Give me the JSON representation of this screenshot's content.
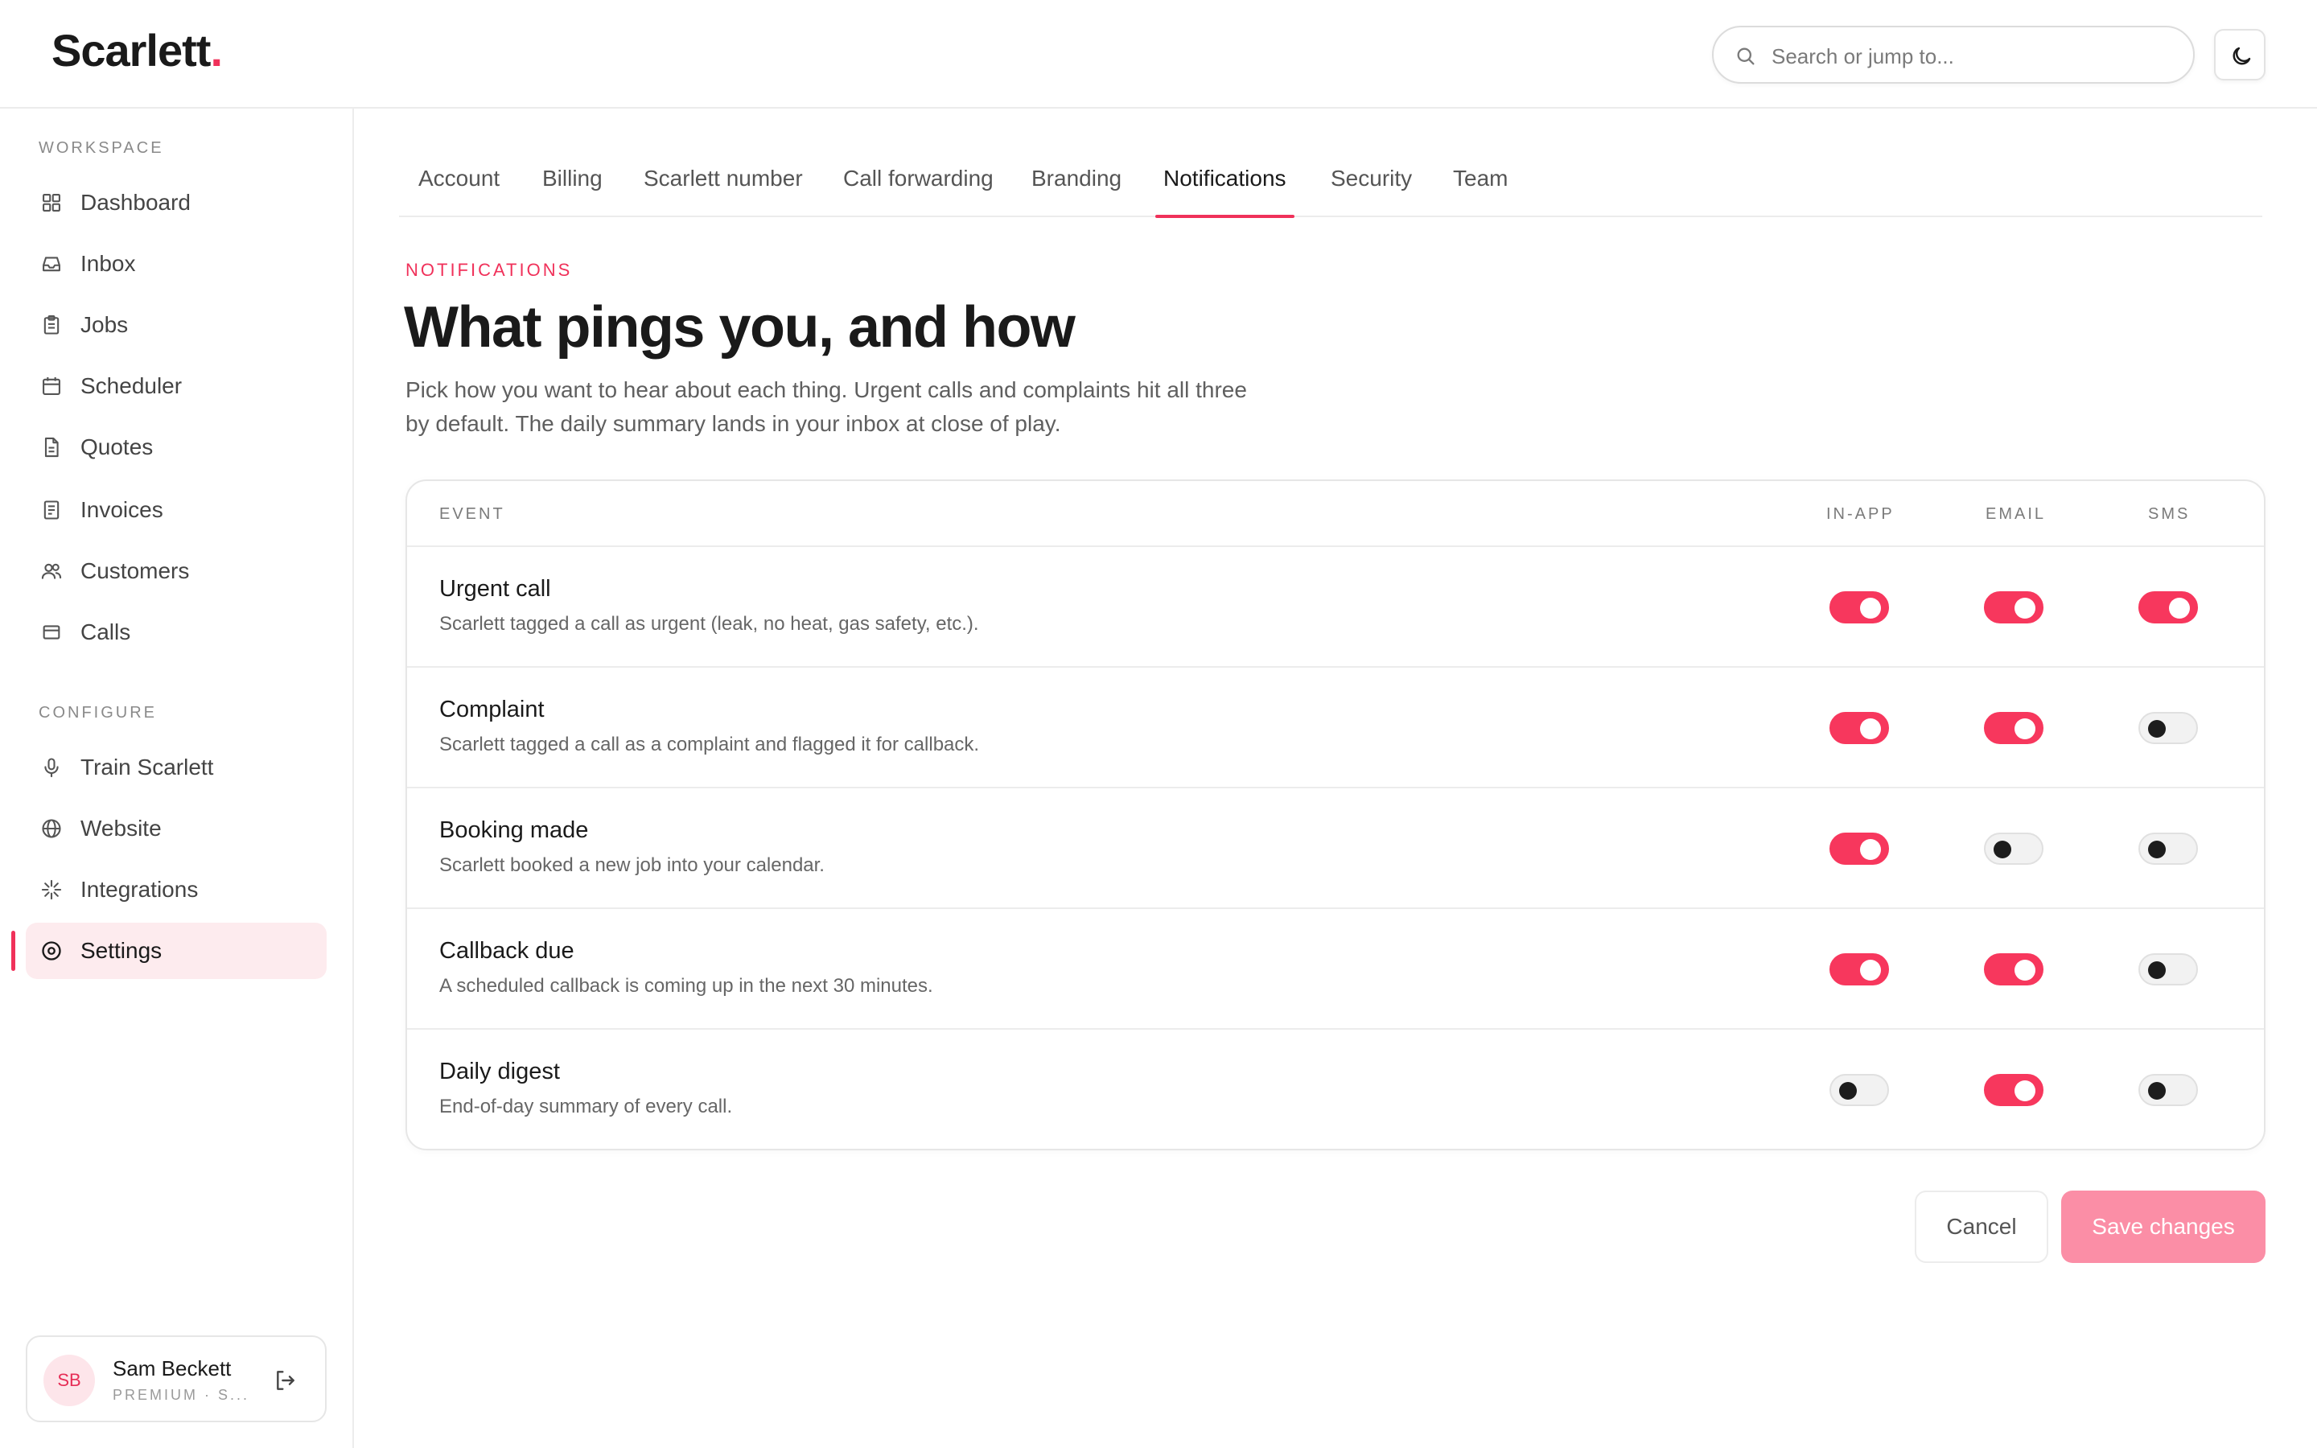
{
  "app": {
    "logo_text": "Scarlett",
    "logo_dot": ".",
    "brand_color": "#f0315a"
  },
  "search": {
    "placeholder": "Search or jump to...",
    "icon": "search-icon"
  },
  "theme_toggle": {
    "icon": "moon-icon"
  },
  "sidebar": {
    "workspace_label": "WORKSPACE",
    "workspace_items": [
      {
        "label": "Dashboard",
        "icon": "dashboard-icon"
      },
      {
        "label": "Inbox",
        "icon": "inbox-icon"
      },
      {
        "label": "Jobs",
        "icon": "clipboard-icon"
      },
      {
        "label": "Scheduler",
        "icon": "calendar-icon"
      },
      {
        "label": "Quotes",
        "icon": "document-icon"
      },
      {
        "label": "Invoices",
        "icon": "receipt-icon"
      },
      {
        "label": "Customers",
        "icon": "users-icon"
      },
      {
        "label": "Calls",
        "icon": "calls-icon"
      }
    ],
    "configure_label": "CONFIGURE",
    "configure_items": [
      {
        "label": "Train Scarlett",
        "icon": "microphone-icon"
      },
      {
        "label": "Website",
        "icon": "globe-icon"
      },
      {
        "label": "Integrations",
        "icon": "sparkle-icon"
      },
      {
        "label": "Settings",
        "icon": "settings-icon",
        "active": true
      }
    ],
    "user": {
      "initials": "SB",
      "name": "Sam Beckett",
      "plan": "PREMIUM · S...",
      "logout_icon": "logout-icon"
    }
  },
  "tabs": [
    {
      "label": "Account"
    },
    {
      "label": "Billing"
    },
    {
      "label": "Scarlett number"
    },
    {
      "label": "Call forwarding"
    },
    {
      "label": "Branding"
    },
    {
      "label": "Notifications",
      "active": true
    },
    {
      "label": "Security"
    },
    {
      "label": "Team"
    }
  ],
  "header": {
    "eyebrow": "NOTIFICATIONS",
    "title": "What pings you, and how",
    "description": "Pick how you want to hear about each thing. Urgent calls and complaints hit all three by default. The daily summary lands in your inbox at close of play."
  },
  "table": {
    "columns": {
      "event": "EVENT",
      "in_app": "IN-APP",
      "email": "EMAIL",
      "sms": "SMS"
    },
    "rows": [
      {
        "name": "Urgent call",
        "description": "Scarlett tagged a call as urgent (leak, no heat, gas safety, etc.).",
        "in_app": true,
        "email": true,
        "sms": true
      },
      {
        "name": "Complaint",
        "description": "Scarlett tagged a call as a complaint and flagged it for callback.",
        "in_app": true,
        "email": true,
        "sms": false
      },
      {
        "name": "Booking made",
        "description": "Scarlett booked a new job into your calendar.",
        "in_app": true,
        "email": false,
        "sms": false
      },
      {
        "name": "Callback due",
        "description": "A scheduled callback is coming up in the next 30 minutes.",
        "in_app": true,
        "email": true,
        "sms": false
      },
      {
        "name": "Daily digest",
        "description": "End-of-day summary of every call.",
        "in_app": false,
        "email": true,
        "sms": false
      }
    ]
  },
  "actions": {
    "cancel_label": "Cancel",
    "save_label": "Save changes"
  }
}
